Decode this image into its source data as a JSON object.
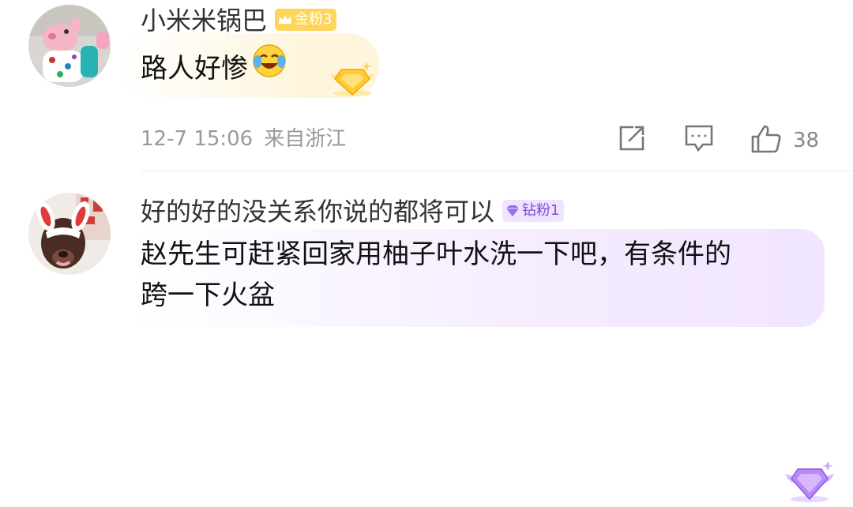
{
  "comments": [
    {
      "username": "小米米锅巴",
      "badge": {
        "label": "金粉3",
        "tier": "gold",
        "icon": "crown-icon"
      },
      "content": "路人好惨",
      "emoji": "laugh-cry-emoji",
      "meta": {
        "date": "12-7 15:06",
        "location": "来自浙江"
      },
      "actions": {
        "like_count": "38"
      },
      "colors": {
        "badge_bg": "#ffd45a",
        "bubble": "#fff3d6"
      }
    },
    {
      "username": "好的好的没关系你说的都将可以",
      "badge": {
        "label": "钻粉1",
        "tier": "diamond",
        "icon": "diamond-icon"
      },
      "content_lines": [
        "赵先生可赶紧回家用柚子叶水洗一下吧，有条件的",
        "跨一下火盆"
      ],
      "colors": {
        "badge_bg": "#efe3ff",
        "bubble": "#f0e4ff"
      }
    }
  ],
  "icons": [
    "share-icon",
    "comment-icon",
    "like-icon"
  ]
}
